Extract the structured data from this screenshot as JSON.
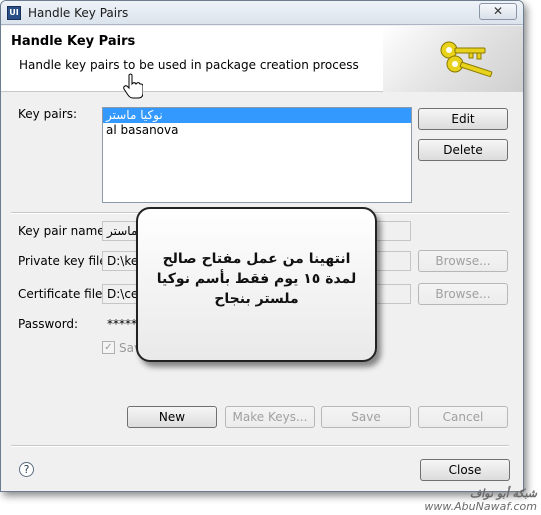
{
  "window": {
    "title": "Handle Key Pairs",
    "app_icon_text": "UI",
    "close_glyph": "✕"
  },
  "banner": {
    "title": "Handle Key Pairs",
    "description": "Handle key pairs to be used in package creation process",
    "art_icon": "keys-icon"
  },
  "key_pairs": {
    "label": "Key pairs:",
    "items": [
      "نوكيا ماستر",
      "al basanova"
    ],
    "selected_index": 0,
    "edit_label": "Edit",
    "delete_label": "Delete"
  },
  "form": {
    "key_pair_name_label": "Key pair name:",
    "key_pair_name_value": "ماستر",
    "private_key_label": "Private key file:",
    "private_key_value": "D:\\ke",
    "certificate_label": "Certificate file:",
    "certificate_value": "D:\\ce",
    "password_label": "Password:",
    "password_value": "*****",
    "save_checkbox_label": "Sav",
    "browse_label": "Browse..."
  },
  "actions": {
    "new_label": "New",
    "make_keys_label": "Make Keys...",
    "save_label": "Save",
    "cancel_label": "Cancel"
  },
  "footer": {
    "help_glyph": "?",
    "close_label": "Close"
  },
  "callout": {
    "text": "انتهينا من عمل مفتاح صالح لمدة ١٥ يوم فقط بأسم نوكيا ملستر بنجاح"
  },
  "watermark": {
    "arabic": "شبكة أبو نواف",
    "url": "www.AbuNawaf.com"
  }
}
